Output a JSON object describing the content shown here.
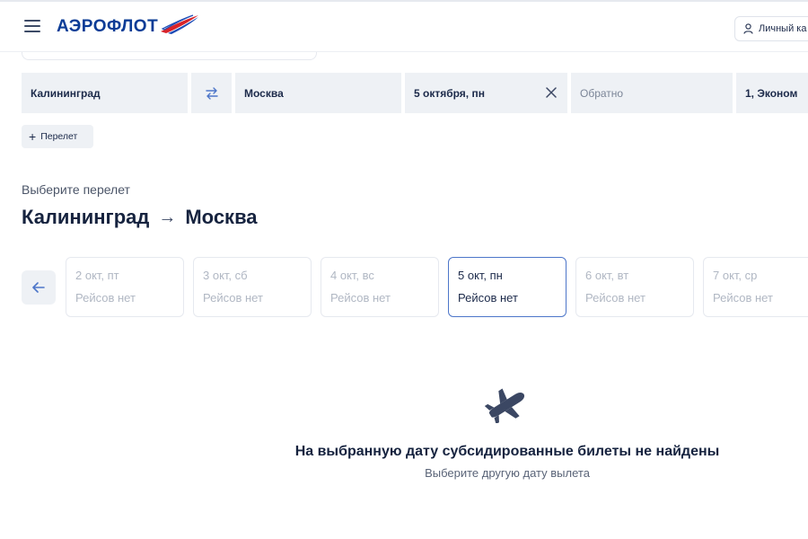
{
  "header": {
    "logo_text": "АЭРОФЛОТ",
    "account_label": "Личный ка"
  },
  "search": {
    "from": "Калининград",
    "to": "Москва",
    "date": "5 октября, пн",
    "return_placeholder": "Обратно",
    "passengers": "1, Эконом",
    "add_flight_label": "Перелет"
  },
  "route": {
    "choose_label": "Выберите перелет",
    "from": "Калининград",
    "arrow": "→",
    "to": "Москва"
  },
  "dates": [
    {
      "date": "2 окт, пт",
      "status": "Рейсов нет",
      "selected": false
    },
    {
      "date": "3 окт, сб",
      "status": "Рейсов нет",
      "selected": false
    },
    {
      "date": "4 окт, вс",
      "status": "Рейсов нет",
      "selected": false
    },
    {
      "date": "5 окт, пн",
      "status": "Рейсов нет",
      "selected": true
    },
    {
      "date": "6 окт, вт",
      "status": "Рейсов нет",
      "selected": false
    },
    {
      "date": "7 окт, ср",
      "status": "Рейсов нет",
      "selected": false
    }
  ],
  "empty_state": {
    "title": "На выбранную дату субсидированные билеты не найдены",
    "subtitle": "Выберите другую дату вылета"
  },
  "colors": {
    "brand": "#0b3c96",
    "flag_red": "#d8232a",
    "selected_border": "#4d76c9",
    "field_bg": "#eef1f5"
  },
  "icons": [
    "menu-icon",
    "aeroflot-wing-icon",
    "user-icon",
    "swap-icon",
    "close-icon",
    "plus-icon",
    "arrow-left-icon",
    "airplane-icon"
  ]
}
